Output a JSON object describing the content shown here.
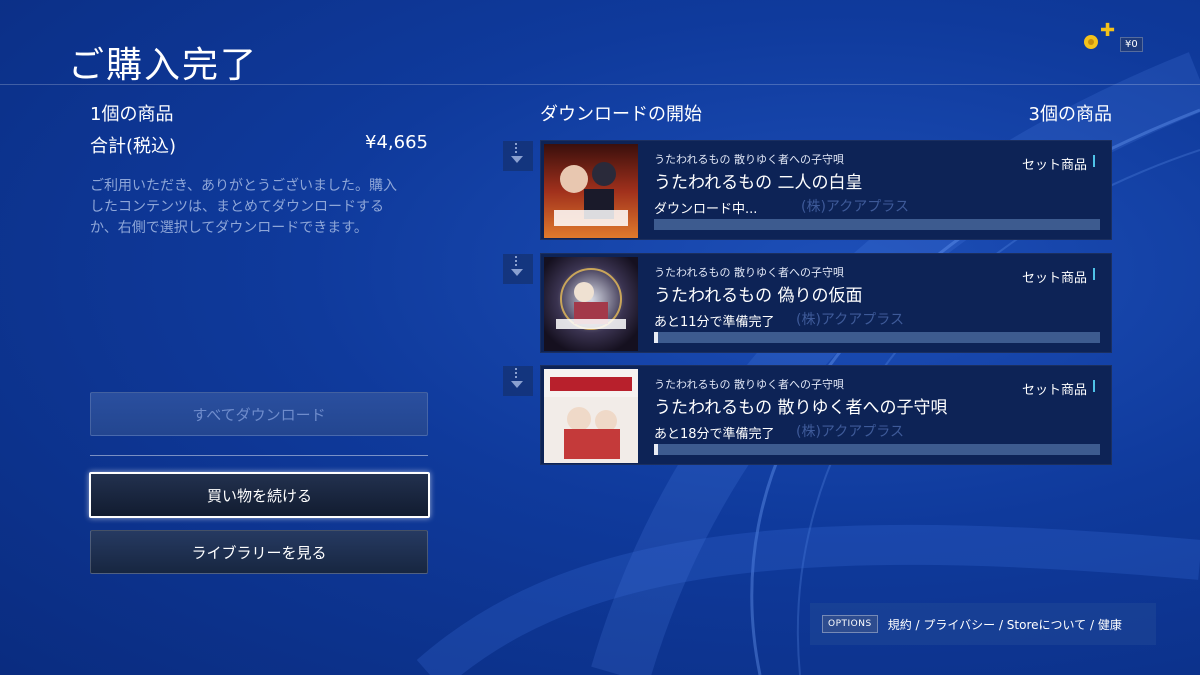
{
  "header": {
    "title": "ご購入完了",
    "wallet_amount": "¥0"
  },
  "summary": {
    "item_count": "1個の商品",
    "total_label": "合計(税込)",
    "total_value": "¥4,665",
    "thanks_text": "ご利用いただき、ありがとうございました。購入したコンテンツは、まとめてダウンロードするか、右側で選択してダウンロードできます。"
  },
  "buttons": {
    "download_all": "すべてダウンロード",
    "continue_shopping": "買い物を続ける",
    "view_library": "ライブラリーを見る"
  },
  "downloads": {
    "heading": "ダウンロードの開始",
    "count": "3個の商品",
    "items": [
      {
        "subtitle": "うたわれるもの 散りゆく者への子守唄",
        "title": "うたわれるもの 二人の白皇",
        "badge": "セット商品",
        "publisher": "(株)アクアプラス",
        "status": "ダウンロード中...",
        "progress": 0.0
      },
      {
        "subtitle": "うたわれるもの 散りゆく者への子守唄",
        "title": "うたわれるもの 偽りの仮面",
        "badge": "セット商品",
        "publisher": "(株)アクアプラス",
        "status": "あと11分で準備完了",
        "progress": 0.01
      },
      {
        "subtitle": "うたわれるもの 散りゆく者への子守唄",
        "title": "うたわれるもの 散りゆく者への子守唄",
        "badge": "セット商品",
        "publisher": "(株)アクアプラス",
        "status": "あと18分で準備完了",
        "progress": 0.01
      }
    ]
  },
  "footer": {
    "options_label": "OPTIONS",
    "links": "規約 / プライバシー / Storeについて / 健康"
  },
  "colors": {
    "accent": "#4fc3e8",
    "background": "#0f3a9c",
    "card": "#0d2356"
  }
}
